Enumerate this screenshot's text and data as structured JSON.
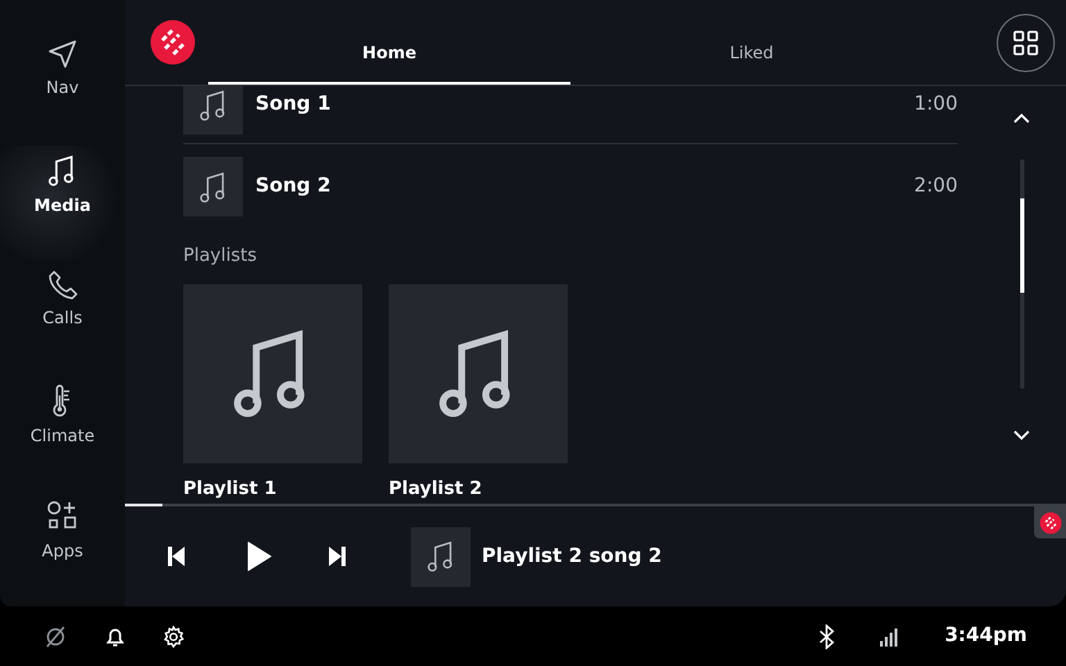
{
  "sidebar": {
    "items": [
      {
        "kind": "nav",
        "label": "Nav",
        "selected": false
      },
      {
        "kind": "media",
        "label": "Media",
        "selected": true
      },
      {
        "kind": "calls",
        "label": "Calls",
        "selected": false
      },
      {
        "kind": "climate",
        "label": "Climate",
        "selected": false
      },
      {
        "kind": "apps",
        "label": "Apps",
        "selected": false
      }
    ]
  },
  "tabs": [
    {
      "label": "Home",
      "selected": true
    },
    {
      "label": "Liked",
      "selected": false
    }
  ],
  "songs": [
    {
      "title": "Song 1",
      "duration": "1:00"
    },
    {
      "title": "Song 2",
      "duration": "2:00"
    }
  ],
  "playlists": {
    "heading": "Playlists",
    "items": [
      {
        "title": "Playlist 1"
      },
      {
        "title": "Playlist 2"
      }
    ]
  },
  "player": {
    "level": 0.04,
    "now_playing": "Playlist 2 song 2"
  },
  "status_bar": {
    "time": "3:44pm"
  }
}
